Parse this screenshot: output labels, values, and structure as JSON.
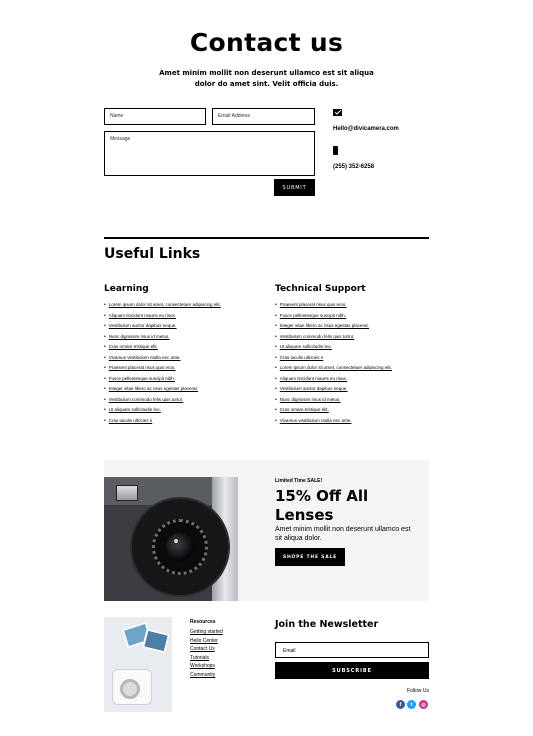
{
  "hero": {
    "title": "Contact us",
    "subtitle": "Amet minim mollit non deserunt ullamco est sit aliqua dolor do amet sint. Velit officia duis."
  },
  "form": {
    "name_placeholder": "Name",
    "email_placeholder": "Email Address",
    "message_placeholder": "Message",
    "submit_label": "SUBMIT"
  },
  "contact": {
    "email": "Hello@divicamera.com",
    "phone": "(255) 352-6258",
    "email_icon": "mail-icon",
    "phone_icon": "phone-icon"
  },
  "links": {
    "title": "Useful Links",
    "learning": {
      "heading": "Learning",
      "items": [
        "Lorem ipsum dolor sit amet, consectetuer adipiscing elit.",
        "Aliquam tincidunt mauris eu risus.",
        "Vestibulum auctor dapibus neque.",
        "Nunc dignissim risus id metus.",
        "Cras ornare tristique elit.",
        "Vivamus vestibulum ntulla nec ante.",
        "Praesent placerat risus quis eros.",
        "Fusce pellentesque suscipit nibh.",
        "Integer vitae libero ac risus egestas placerat.",
        "Vestibulum commodo felis quis tortor.",
        "Ut aliquam sollicitudin leo.",
        "Cras iaculis ultricies n"
      ]
    },
    "support": {
      "heading": "Technical Support",
      "items": [
        "Praesent placerat risus quis eros.",
        "Fusce pellentesque suscipit nibh.",
        "Integer vitae libero ac risus egestas placerat.",
        "Vestibulum commodo felis quis tortor.",
        "Ut aliquam sollicitudin leo.",
        "Cras iaculis ultricies n",
        "Lorem ipsum dolor sit amet, consectetuer adipiscing elit.",
        "Aliquam tincidunt mauris eu risus.",
        "Vestibulum auctor dapibus neque.",
        "Nunc dignissim risus id metus.",
        "Cras ornare tristique elit.",
        "Vivamus vestibulum ntulla nec ante."
      ]
    }
  },
  "promo": {
    "tag": "Limited Time SALE!",
    "title": "15% Off All Lenses",
    "description": "Amet minim mollit non deserunt ullamco est sit aliqua dolor.",
    "button_label": "SHOPE THE SALE"
  },
  "footer": {
    "resources_title": "Resources",
    "resources": [
      "Getting started",
      "Hello Center",
      "Contact Us",
      "Tutorials",
      "Workshops",
      "Community"
    ],
    "newsletter_title": "Join the Newsletter",
    "email_placeholder": "Email",
    "subscribe_label": "SUBSCRIBE",
    "follow_label": "Follow Us",
    "social": [
      {
        "icon": "facebook-icon",
        "glyph": "f",
        "color": "#3b5998"
      },
      {
        "icon": "twitter-icon",
        "glyph": "t",
        "color": "#1da1f2"
      },
      {
        "icon": "instagram-icon",
        "glyph": "◎",
        "color": "#c13584"
      }
    ]
  }
}
